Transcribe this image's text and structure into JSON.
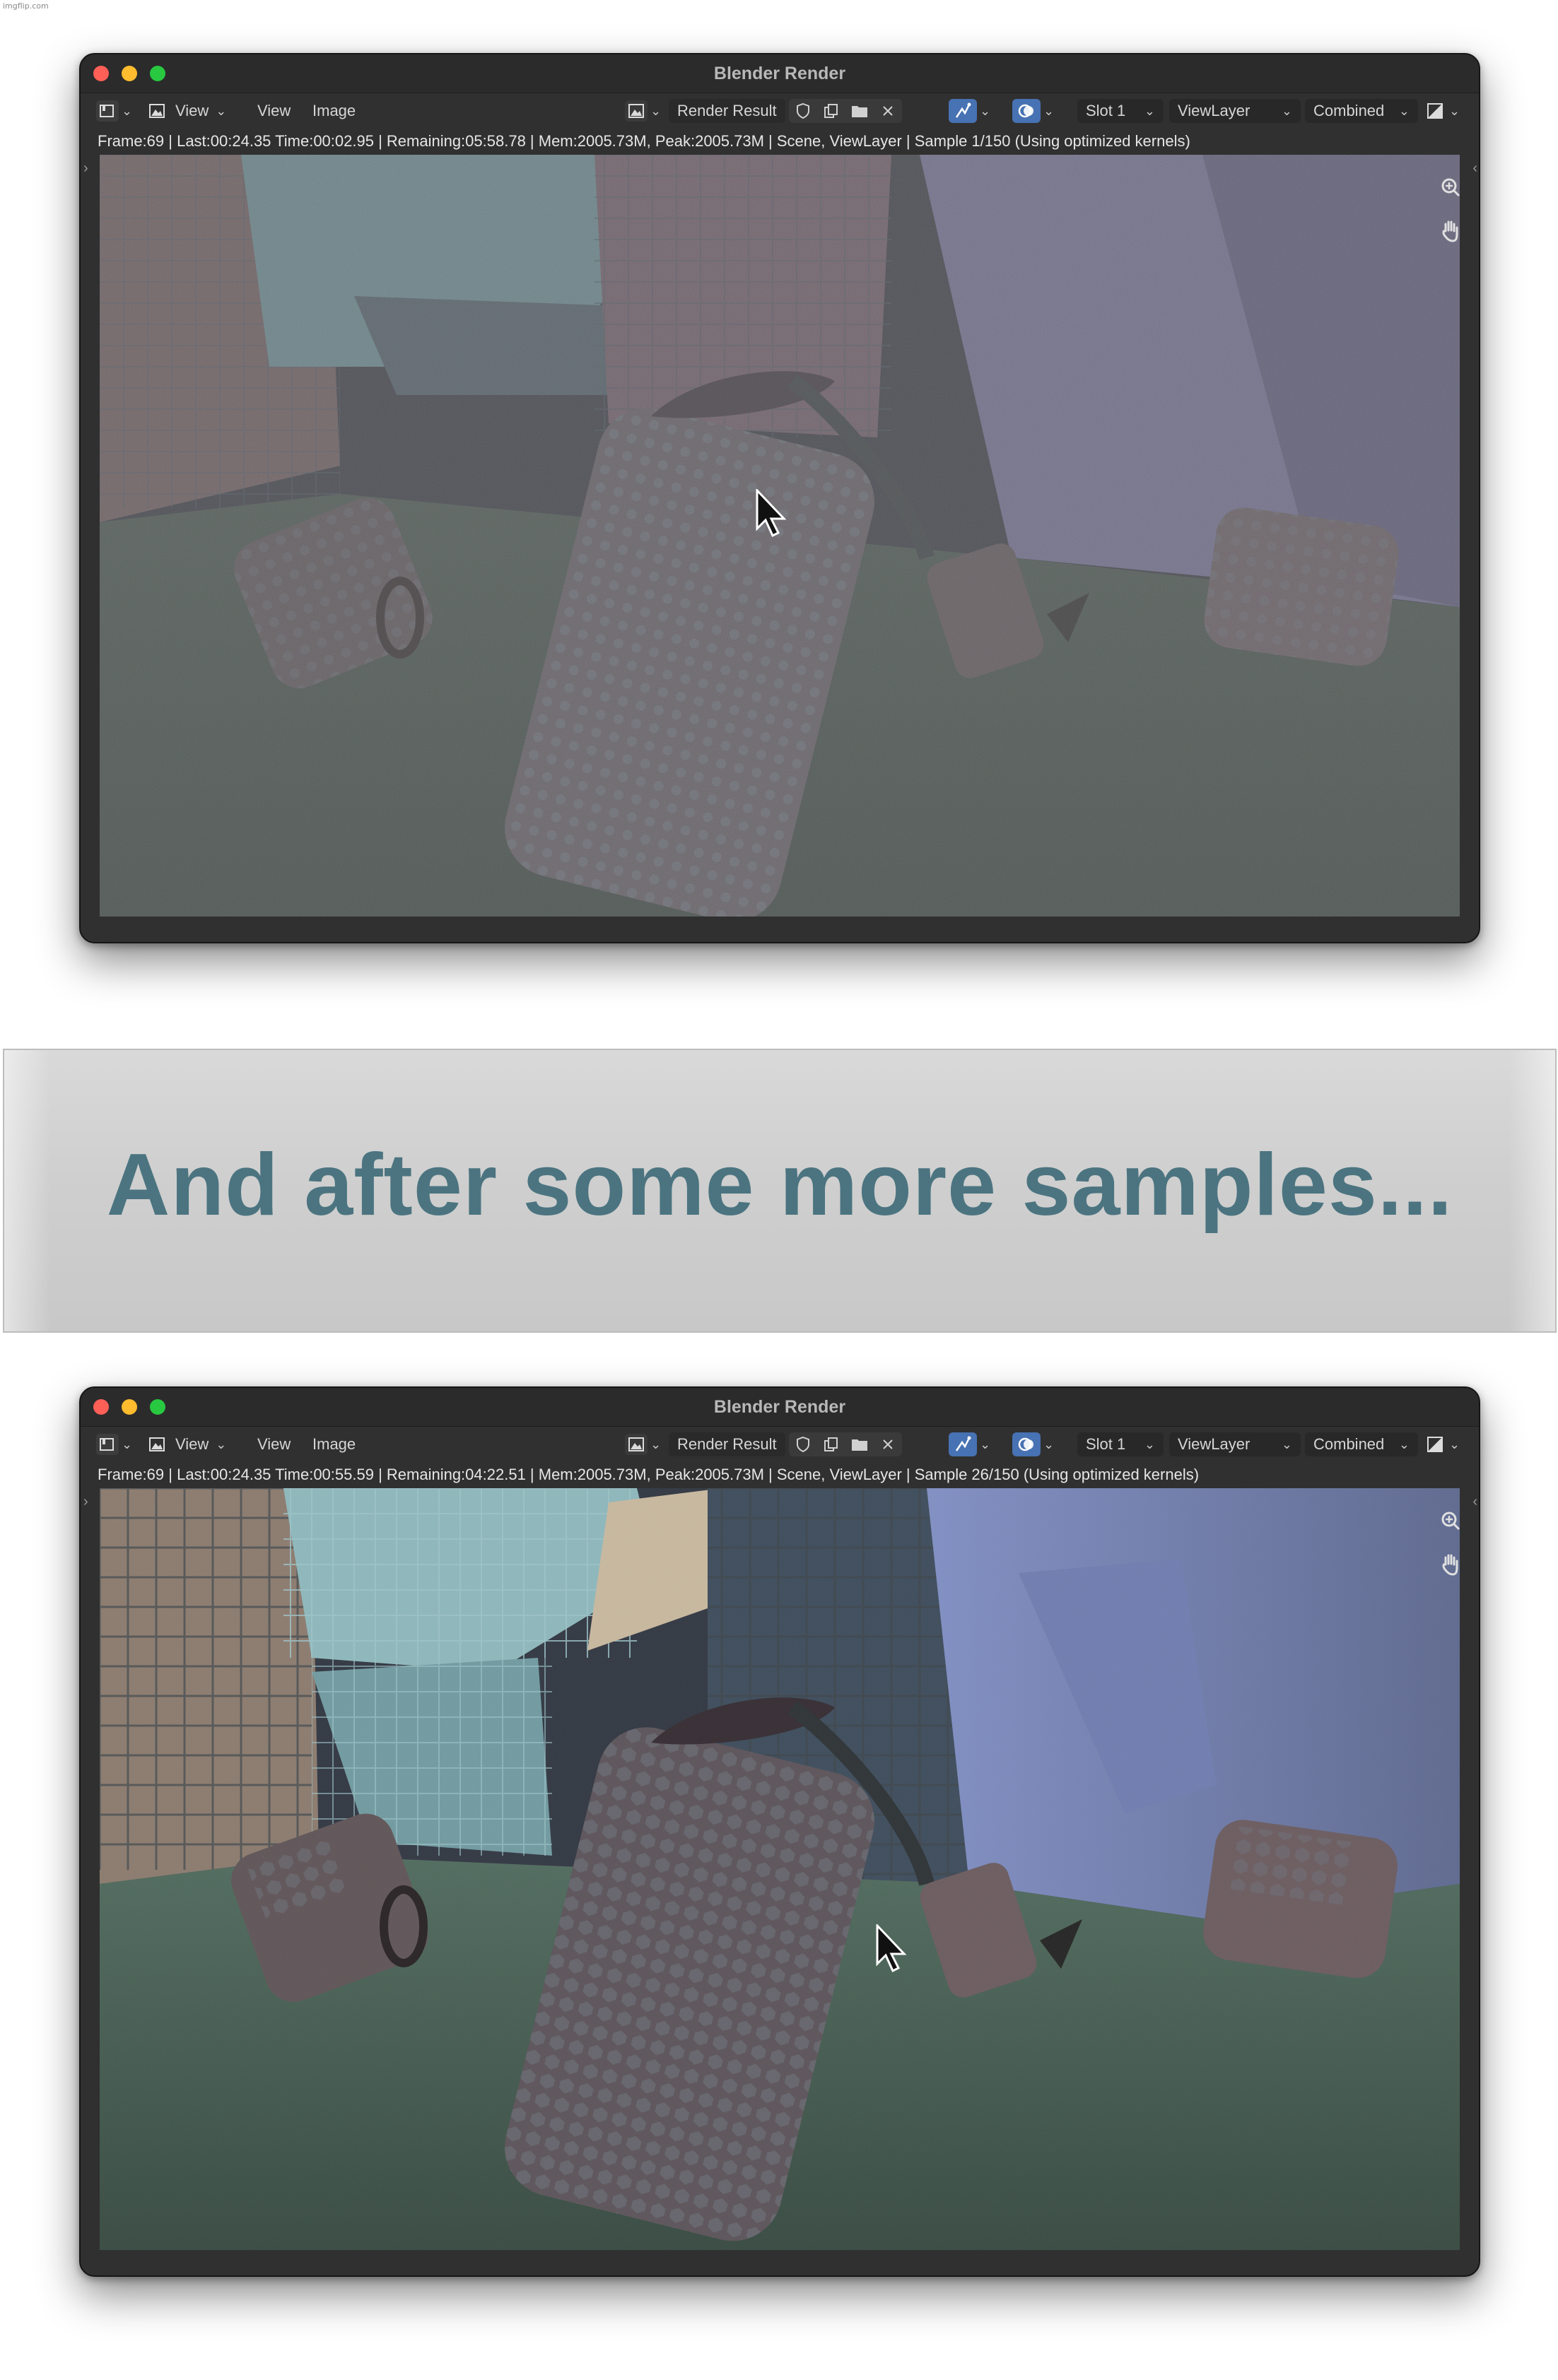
{
  "watermark": "imgflip.com",
  "banner": {
    "text": "And after some more samples..."
  },
  "windows": [
    {
      "title": "Blender Render",
      "menu": {
        "view1": "View",
        "view2": "View",
        "image": "Image"
      },
      "image_name": "Render Result",
      "slot": "Slot 1",
      "view_layer": "ViewLayer",
      "pass": "Combined",
      "status": "Frame:69 | Last:00:24.35 Time:00:02.95 | Remaining:05:58.78 | Mem:2005.73M, Peak:2005.73M | Scene, ViewLayer | Sample 1/150 (Using optimized kernels)",
      "render_progress": {
        "sample": 1,
        "total": 150
      }
    },
    {
      "title": "Blender Render",
      "menu": {
        "view1": "View",
        "view2": "View",
        "image": "Image"
      },
      "image_name": "Render Result",
      "slot": "Slot 1",
      "view_layer": "ViewLayer",
      "pass": "Combined",
      "status": "Frame:69 | Last:00:24.35 Time:00:55.59 | Remaining:04:22.51 | Mem:2005.73M, Peak:2005.73M | Scene, ViewLayer | Sample 26/150 (Using optimized kernels)",
      "render_progress": {
        "sample": 26,
        "total": 150
      }
    }
  ],
  "icons": {
    "editor_type": "image-editor-icon",
    "image_browse": "image-browse-icon",
    "fake_user": "shield-icon",
    "new_image": "duplicate-icon",
    "open_image": "folder-icon",
    "unlink": "close-icon",
    "gizmo_toggle": "gizmo-icon",
    "overlay_toggle": "overlay-icon",
    "display_channels": "display-channels-icon",
    "zoom": "zoom-icon",
    "pan": "hand-icon",
    "cursor": "mouse-cursor-icon"
  },
  "colors": {
    "window_bg": "#303030",
    "accent_blue": "#4772b3",
    "banner_text": "#4b7480"
  }
}
